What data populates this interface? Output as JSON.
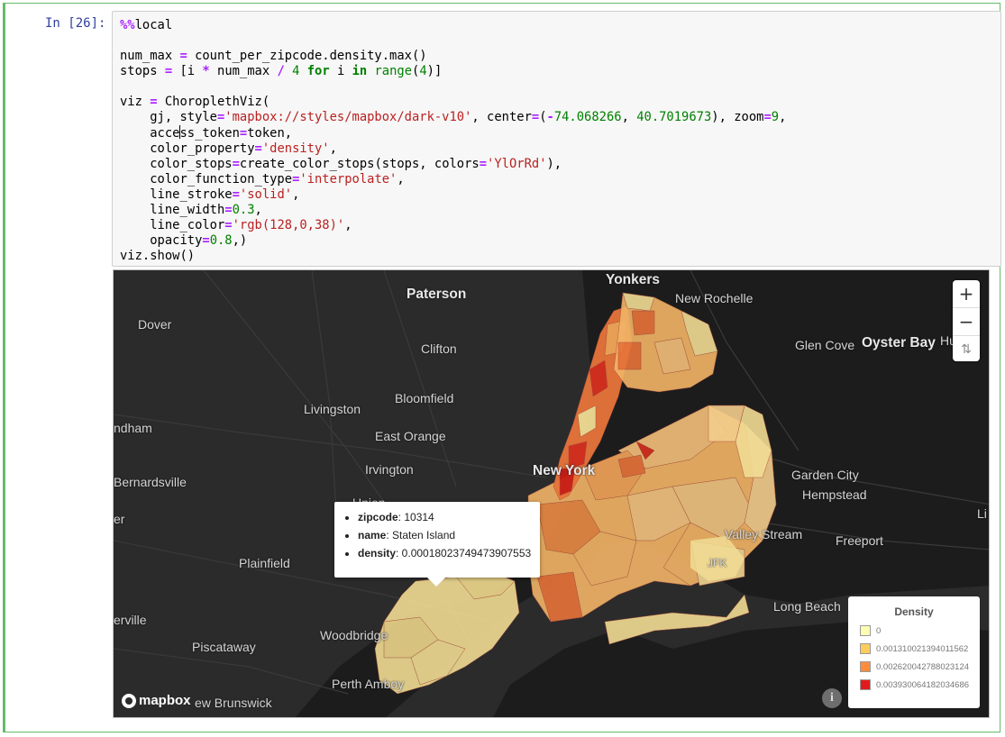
{
  "cell": {
    "prompt": "In [26]:",
    "code_lines": [
      "%%local",
      "",
      "num_max = count_per_zipcode.density.max()",
      "stops = [i * num_max / 4 for i in range(4)]",
      "",
      "viz = ChoroplethViz(",
      "    gj, style='mapbox://styles/mapbox/dark-v10', center=(-74.068266, 40.7019673), zoom=9,",
      "    access_token=token,",
      "    color_property='density',",
      "    color_stops=create_color_stops(stops, colors='YlOrRd'),",
      "    color_function_type='interpolate',",
      "    line_stroke='solid',",
      "    line_width=0.3,",
      "    line_color='rgb(128,0,38)',",
      "    opacity=0.8,)",
      "viz.show()"
    ]
  },
  "map": {
    "places": [
      {
        "name": "Yonkers",
        "big": true
      },
      {
        "name": "Paterson",
        "big": true
      },
      {
        "name": "New Rochelle",
        "big": false
      },
      {
        "name": "Dover",
        "big": false
      },
      {
        "name": "Clifton",
        "big": false
      },
      {
        "name": "Glen Cove",
        "big": false
      },
      {
        "name": "Oyster Bay",
        "big": true
      },
      {
        "name": "Hu",
        "big": false
      },
      {
        "name": "Bloomfield",
        "big": false
      },
      {
        "name": "Livingston",
        "big": false
      },
      {
        "name": "ndham",
        "big": false
      },
      {
        "name": "East Orange",
        "big": false
      },
      {
        "name": "Irvington",
        "big": false
      },
      {
        "name": "New York",
        "big": true
      },
      {
        "name": "Bernardsville",
        "big": false
      },
      {
        "name": "Garden City",
        "big": false
      },
      {
        "name": "Hempstead",
        "big": false
      },
      {
        "name": "Union",
        "big": false
      },
      {
        "name": "er",
        "big": false
      },
      {
        "name": "Li",
        "big": false
      },
      {
        "name": "Valley Stream",
        "big": false
      },
      {
        "name": "Freeport",
        "big": false
      },
      {
        "name": "Plainfield",
        "big": false
      },
      {
        "name": "JFK",
        "big": false
      },
      {
        "name": "Long Beach",
        "big": false
      },
      {
        "name": "erville",
        "big": false
      },
      {
        "name": "Woodbridge",
        "big": false
      },
      {
        "name": "Piscataway",
        "big": false
      },
      {
        "name": "Perth Amboy",
        "big": false
      },
      {
        "name": "ew Brunswick",
        "big": false
      }
    ],
    "controls": {
      "zoom_in": "+",
      "zoom_out": "−",
      "compass": "⇅"
    },
    "popup": {
      "fields": [
        {
          "key": "zipcode",
          "value": ": 10314"
        },
        {
          "key": "name",
          "value": ": Staten Island"
        },
        {
          "key": "density",
          "value": ": 0.00018023749473907553"
        }
      ]
    },
    "legend": {
      "title": "Density",
      "items": [
        {
          "label": "0",
          "color": "#ffffb2"
        },
        {
          "label": "0.001310021394011562",
          "color": "#fecc5c"
        },
        {
          "label": "0.002620042788023124",
          "color": "#fd8d3c"
        },
        {
          "label": "0.003930064182034686",
          "color": "#e31a1c"
        }
      ]
    },
    "attribution": {
      "logo_text": "mapbox",
      "info": "i"
    },
    "colors": {
      "background": "#2b2b2b",
      "water": "#1a1a1a",
      "roads": "#3d3d3d",
      "zone_low": "#f1dc94",
      "zone_mid": "#f2b466",
      "zone_high": "#e8743a",
      "zone_max": "#d7301f",
      "zone_stroke": "#b0503c"
    }
  }
}
